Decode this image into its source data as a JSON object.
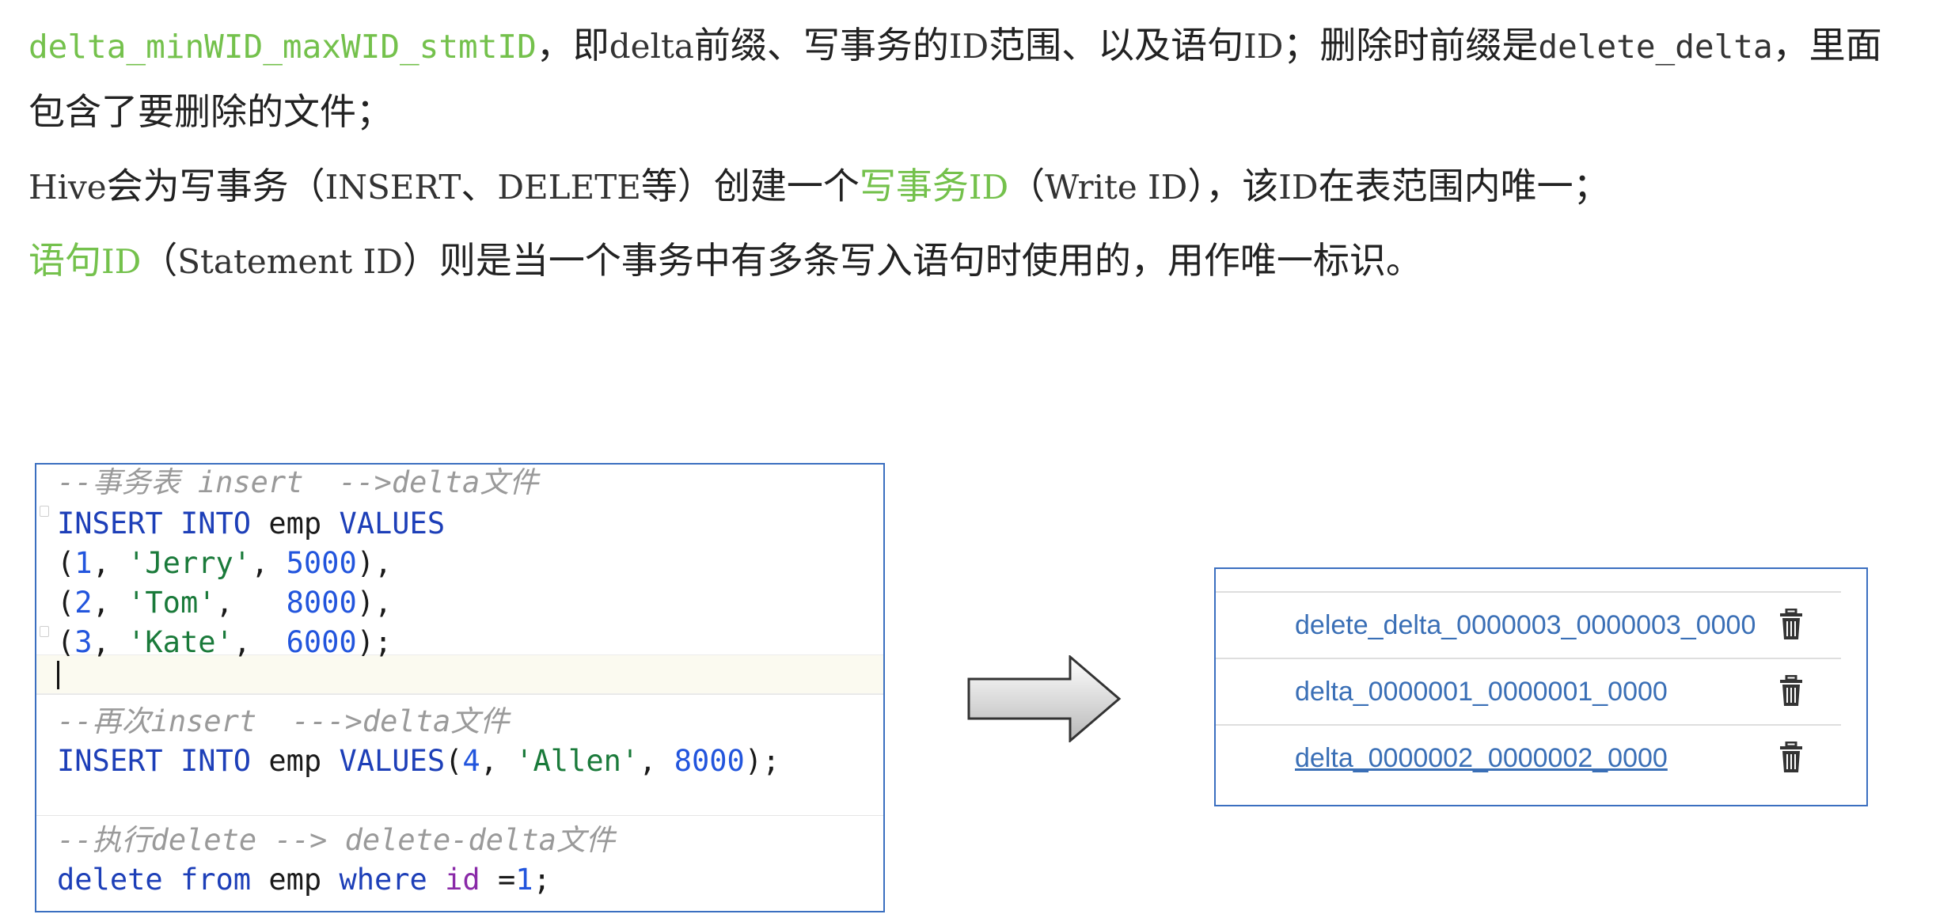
{
  "paragraphs": {
    "p1": {
      "term": "delta_minWID_maxWID_stmtID",
      "text_a": "，即",
      "mono_delta": "delta",
      "text_b": "前缀、写事务的",
      "mono_id": "ID",
      "text_c": "范围、以及语句",
      "mono_id2": "ID",
      "text_d": "；删除时前缀是",
      "mono_delete_delta": "delete_delta",
      "text_e": "，里面",
      "line2": "包含了要删除的文件；"
    },
    "p2": {
      "hive": "Hive",
      "text_a": "会为写事务（",
      "insert": "INSERT",
      "text_b": "、",
      "delete": "DELETE",
      "text_c": "等）创建一个",
      "green_term": "写事务",
      "green_id": "ID",
      "text_d": "（",
      "write_id": "Write ID",
      "text_e": "），该",
      "id": "ID",
      "text_f": "在表范围内唯一；"
    },
    "p3": {
      "green_term": "语句",
      "green_id": "ID",
      "text_a": "（",
      "statement_id": "Statement ID",
      "text_b": "）则是当一个事务中有多条写入语句时使用的，用作唯一标识。"
    }
  },
  "code": {
    "comment1": "--事务表 insert  -->delta文件",
    "l1_kw1": "INSERT",
    "l1_kw2": "INTO",
    "l1_tbl": "emp",
    "l1_kw3": "VALUES",
    "rows": [
      {
        "open": "(",
        "n": "1",
        "sep1": ", ",
        "s": "'Jerry'",
        "sep2": ", ",
        "v": "5000",
        "close": "),"
      },
      {
        "open": "(",
        "n": "2",
        "sep1": ", ",
        "s": "'Tom'",
        "sep2": ",   ",
        "v": "8000",
        "close": "),"
      },
      {
        "open": "(",
        "n": "3",
        "sep1": ", ",
        "s": "'Kate'",
        "sep2": ",  ",
        "v": "6000",
        "close": ");"
      }
    ],
    "comment2": "--再次insert  --->delta文件",
    "l2_kw1": "INSERT",
    "l2_kw2": "INTO",
    "l2_tbl": "emp",
    "l2_kw3": "VALUES",
    "l2_open": "(",
    "l2_n": "4",
    "l2_sep1": ", ",
    "l2_s": "'Allen'",
    "l2_sep2": ", ",
    "l2_v": "8000",
    "l2_close": ");",
    "comment3": "--执行delete --> delete-delta文件",
    "l3_kw1": "delete",
    "l3_kw2": "from",
    "l3_tbl": "emp",
    "l3_kw3": "where",
    "l3_col": "id",
    "l3_op": " =",
    "l3_n": "1",
    "l3_end": ";"
  },
  "files": [
    {
      "name": "delete_delta_0000003_0000003_0000",
      "icon": "trash-icon"
    },
    {
      "name": "delta_0000001_0000001_0000",
      "icon": "trash-icon"
    },
    {
      "name": "delta_0000002_0000002_0000",
      "icon": "trash-icon"
    }
  ],
  "colors": {
    "highlight_green": "#74c14c",
    "border_blue": "#3b6fc0",
    "keyword_blue": "#1d3fb8",
    "string_green": "#1a7a3a",
    "link_blue": "#3a6fb6"
  }
}
